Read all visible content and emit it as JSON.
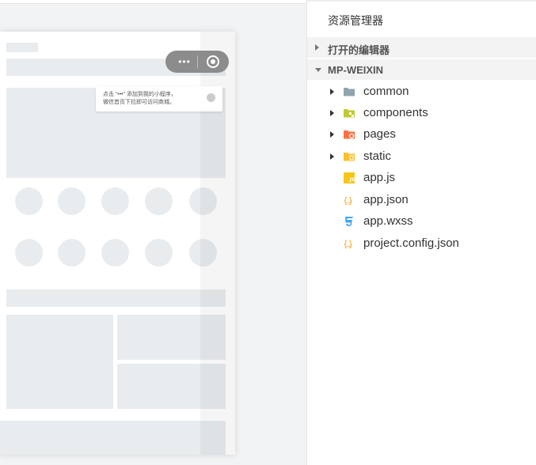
{
  "explorer": {
    "title": "资源管理器",
    "sections": [
      {
        "label": "打开的编辑器",
        "expanded": false
      },
      {
        "label": "MP-WEIXIN",
        "expanded": true
      }
    ],
    "tree": [
      {
        "name": "common",
        "type": "folder",
        "icon": "folder-icon",
        "color": "#90a4ae"
      },
      {
        "name": "components",
        "type": "folder",
        "icon": "components-folder-icon",
        "color": "#c0ca33"
      },
      {
        "name": "pages",
        "type": "folder",
        "icon": "pages-folder-icon",
        "color": "#ff7043"
      },
      {
        "name": "static",
        "type": "folder",
        "icon": "static-folder-icon",
        "color": "#fbc02d"
      },
      {
        "name": "app.js",
        "type": "file",
        "icon": "js-file-icon",
        "color": "#f5c518"
      },
      {
        "name": "app.json",
        "type": "file",
        "icon": "json-file-icon",
        "color": "#f9a825"
      },
      {
        "name": "app.wxss",
        "type": "file",
        "icon": "css-file-icon",
        "color": "#42a5f5"
      },
      {
        "name": "project.config.json",
        "type": "file",
        "icon": "json-file-icon",
        "color": "#f9a825"
      }
    ]
  },
  "simulator": {
    "capsule": {
      "more_label": "•••"
    },
    "tip": {
      "line1": "点击 “•••” 添加到我的小程序，",
      "line2": "微信首页下拉即可访问商城。"
    }
  }
}
